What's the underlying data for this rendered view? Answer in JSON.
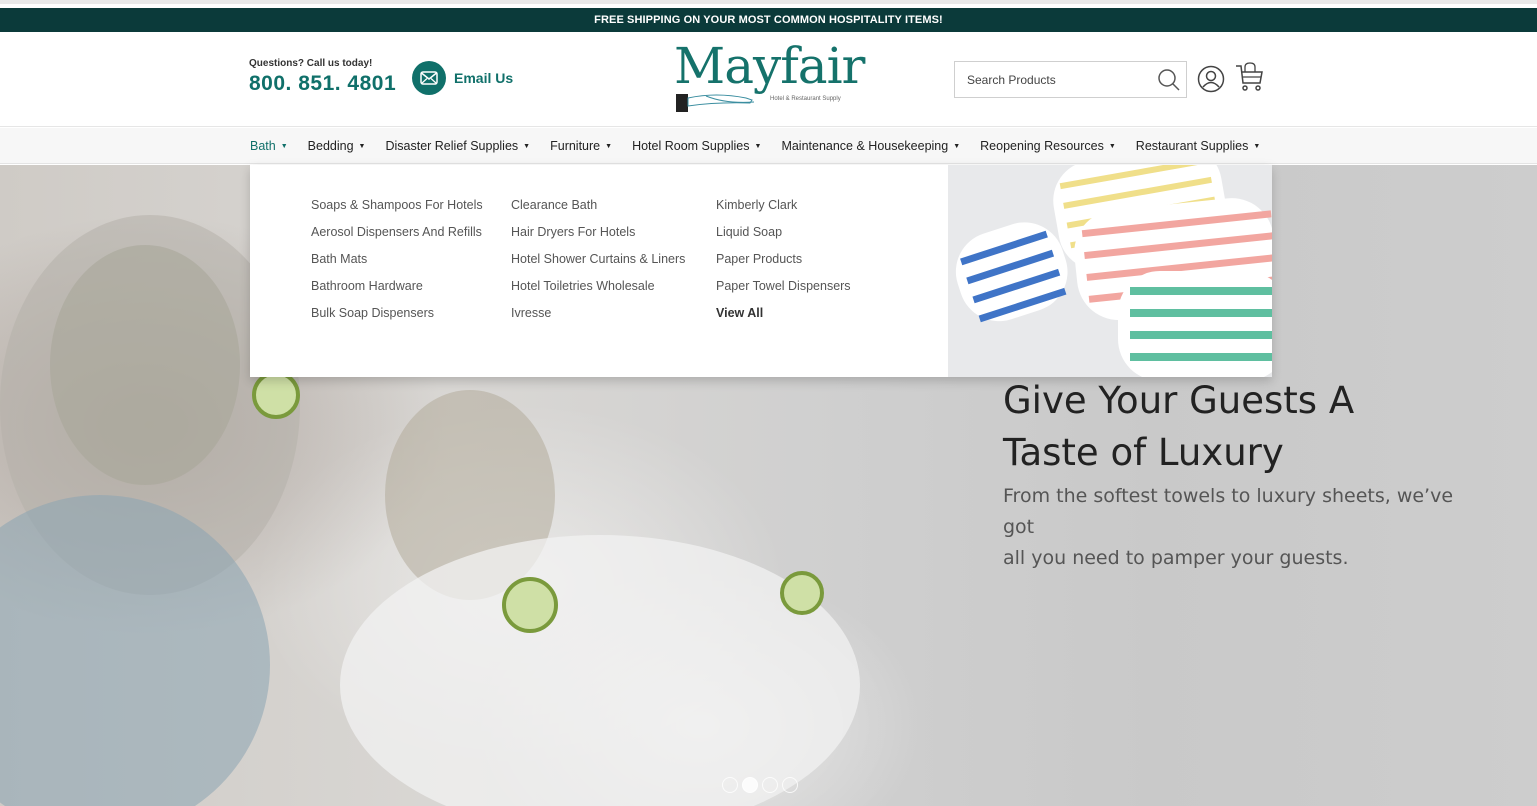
{
  "promo": {
    "text": "FREE SHIPPING ON YOUR MOST COMMON HOSPITALITY ITEMS!"
  },
  "header": {
    "question": "Questions? Call us today!",
    "phone": "800. 851. 4801",
    "email_label": "Email Us",
    "logo_word": "Mayfair",
    "logo_tagline": "Hotel & Restaurant Supply",
    "search_placeholder": "Search Products"
  },
  "nav": [
    {
      "label": "Bath"
    },
    {
      "label": "Bedding"
    },
    {
      "label": "Disaster Relief Supplies"
    },
    {
      "label": "Furniture"
    },
    {
      "label": "Hotel Room Supplies"
    },
    {
      "label": "Maintenance & Housekeeping"
    },
    {
      "label": "Reopening Resources"
    },
    {
      "label": "Restaurant Supplies"
    }
  ],
  "mega": {
    "col1": [
      "Soaps & Shampoos For Hotels",
      "Aerosol Dispensers And Refills",
      "Bath Mats",
      "Bathroom Hardware",
      "Bulk Soap Dispensers"
    ],
    "col2": [
      "Clearance Bath",
      "Hair Dryers For Hotels",
      "Hotel Shower Curtains & Liners",
      "Hotel Toiletries Wholesale",
      "Ivresse"
    ],
    "col3": [
      "Kimberly Clark",
      "Liquid Soap",
      "Paper Products",
      "Paper Towel Dispensers",
      "View All"
    ]
  },
  "hero": {
    "title_line1": "Give Your Guests A",
    "title_line2": "Taste of Luxury",
    "subtitle_line1": "From the softest towels to luxury sheets, we’ve got",
    "subtitle_line2": "all you need to pamper your guests."
  },
  "colors": {
    "brand": "#10706a",
    "promo_bg": "#0b3a3a"
  }
}
